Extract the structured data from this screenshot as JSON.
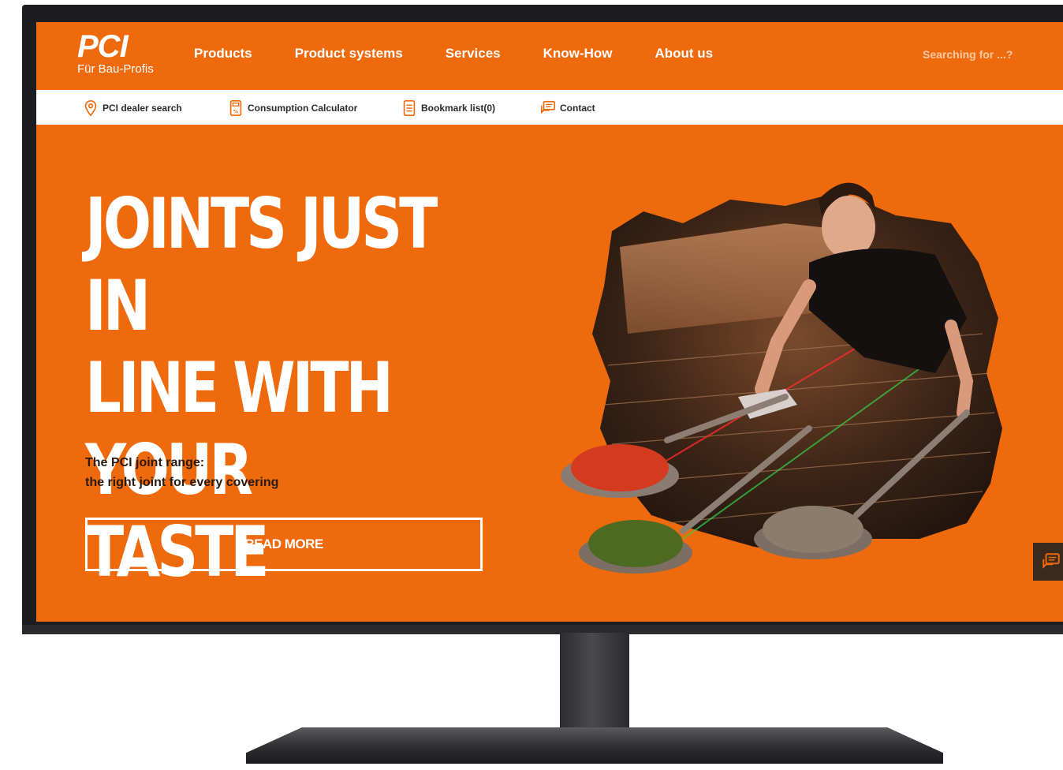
{
  "header": {
    "logo_text": "PCI",
    "logo_tagline": "Für Bau-Profis",
    "nav": [
      "Products",
      "Product systems",
      "Services",
      "Know-How",
      "About us"
    ],
    "search_placeholder": "Searching for ...?"
  },
  "utility_bar": {
    "dealer_search": "PCI dealer search",
    "consumption_calculator": "Consumption Calculator",
    "bookmark_list": "Bookmark list(0)",
    "contact": "Contact"
  },
  "hero": {
    "title_lines": [
      "JOINTS JUST IN",
      "LINE WITH YOUR",
      "TASTE"
    ],
    "subtitle_lines": [
      "The PCI joint range:",
      "the right joint for every covering"
    ],
    "cta_label": "READ MORE"
  },
  "colors": {
    "brand_orange": "#ef6a0c",
    "white": "#ffffff",
    "bezel": "#1d1d1f"
  },
  "icons": {
    "dealer_search": "location-pin-icon",
    "consumption_calculator": "calculator-icon",
    "bookmark_list": "bookmark-list-icon",
    "contact": "chat-bubble-icon",
    "floating_contact": "chat-bubble-icon"
  }
}
